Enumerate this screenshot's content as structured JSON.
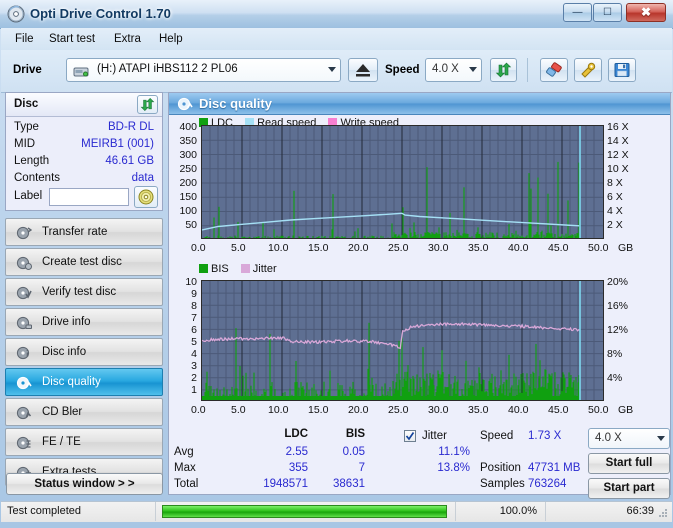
{
  "window": {
    "title": "Opti Drive Control 1.70",
    "icon": "disc-icon",
    "buttons": {
      "minimize": "–",
      "maximize": "❐",
      "close": "✕"
    }
  },
  "menu": {
    "items": [
      "File",
      "Start test",
      "Extra",
      "Help"
    ]
  },
  "toolbar": {
    "drive_label": "Drive",
    "drive_value": "(H:)  ATAPI iHBS112  2 PL06",
    "eject_icon": "eject-icon",
    "speed_label": "Speed",
    "speed_value": "4.0 X",
    "refresh_icon": "refresh-icon",
    "erase_icon": "eraser-icon",
    "tools_icon": "tools-icon",
    "save_icon": "save-icon"
  },
  "disc": {
    "header": "Disc",
    "refresh_icon": "refresh-icon",
    "rows": [
      {
        "key": "Type",
        "value": "BD-R DL"
      },
      {
        "key": "MID",
        "value": "MEIRB1 (001)"
      },
      {
        "key": "Length",
        "value": "46.61 GB"
      },
      {
        "key": "Contents",
        "value": "data"
      }
    ],
    "label_key": "Label",
    "label_value": "",
    "label_placeholder": "",
    "label_button_icon": "disc-icon"
  },
  "nav": {
    "items": [
      {
        "label": "Transfer rate",
        "icon": "disc-transfer-icon",
        "selected": false
      },
      {
        "label": "Create test disc",
        "icon": "disc-create-icon",
        "selected": false
      },
      {
        "label": "Verify test disc",
        "icon": "disc-verify-icon",
        "selected": false
      },
      {
        "label": "Drive info",
        "icon": "disc-drive-icon",
        "selected": false
      },
      {
        "label": "Disc info",
        "icon": "disc-info-icon",
        "selected": false
      },
      {
        "label": "Disc quality",
        "icon": "disc-quality-icon",
        "selected": true
      },
      {
        "label": "CD Bler",
        "icon": "disc-bler-icon",
        "selected": false
      },
      {
        "label": "FE / TE",
        "icon": "disc-fete-icon",
        "selected": false
      },
      {
        "label": "Extra tests",
        "icon": "disc-extra-icon",
        "selected": false
      }
    ],
    "status_window": "Status window > >"
  },
  "content": {
    "title": "Disc quality",
    "icon": "disc-quality-icon"
  },
  "chart_data": [
    {
      "type": "line",
      "title": "LDC / Read speed",
      "xlabel": "GB",
      "ylabel": "LDC errors",
      "x_ticks": [
        "0.0",
        "5.0",
        "10.0",
        "15.0",
        "20.0",
        "25.0",
        "30.0",
        "35.0",
        "40.0",
        "45.0",
        "50.0"
      ],
      "xlim": [
        0,
        50
      ],
      "y_left_ticks": [
        "50",
        "100",
        "150",
        "200",
        "250",
        "300",
        "350",
        "400"
      ],
      "ylim": [
        0,
        400
      ],
      "y_right_ticks": [
        "2 X",
        "4 X",
        "6 X",
        "8 X",
        "10 X",
        "12 X",
        "14 X",
        "16 X"
      ],
      "ylim_right": [
        0,
        16
      ],
      "x_unit": "GB",
      "grid": true,
      "legend": [
        {
          "label": "LDC",
          "color": "#10a010"
        },
        {
          "label": "Read speed",
          "color": "#a5e0f5"
        },
        {
          "label": "Write speed",
          "color": "#f77fd0"
        }
      ],
      "series": [
        {
          "name": "Read speed",
          "color": "#a5e0f5",
          "unit": "X",
          "x": [
            0,
            2,
            5,
            8,
            11,
            14,
            17,
            20,
            23,
            24.8,
            25.2,
            27,
            30,
            33,
            36,
            39,
            42,
            45,
            46.8
          ],
          "values": [
            1.4,
            1.9,
            2.2,
            2.5,
            2.8,
            3.0,
            3.2,
            3.4,
            3.6,
            3.75,
            3.5,
            3.3,
            3.1,
            2.9,
            2.7,
            2.5,
            2.3,
            2.1,
            2.0
          ]
        },
        {
          "name": "LDC",
          "color": "#10a010",
          "description": "dense green error spikes across the whole disc, mostly below 60 with occasional peaks to 355",
          "avg": 2.55,
          "max": 355,
          "total": 1948571
        }
      ]
    },
    {
      "type": "line",
      "title": "BIS / Jitter",
      "xlabel": "GB",
      "ylabel": "BIS errors",
      "x_ticks": [
        "0.0",
        "5.0",
        "10.0",
        "15.0",
        "20.0",
        "25.0",
        "30.0",
        "35.0",
        "40.0",
        "45.0",
        "50.0"
      ],
      "xlim": [
        0,
        50
      ],
      "y_left_ticks": [
        "1",
        "2",
        "3",
        "4",
        "5",
        "6",
        "7",
        "8",
        "9",
        "10"
      ],
      "ylim": [
        0,
        10
      ],
      "y_right_ticks": [
        "4%",
        "8%",
        "12%",
        "16%",
        "20%"
      ],
      "ylim_right": [
        0,
        20
      ],
      "x_unit": "GB",
      "grid": true,
      "legend": [
        {
          "label": "BIS",
          "color": "#10a010"
        },
        {
          "label": "Jitter",
          "color": "#d9a8d9"
        }
      ],
      "series": [
        {
          "name": "Jitter",
          "color": "#d9a8d9",
          "unit": "%",
          "x": [
            0,
            3,
            7,
            10,
            11,
            14,
            18,
            21,
            23,
            24.6,
            24.9,
            26,
            28,
            31,
            34,
            37,
            40,
            43,
            46,
            46.9
          ],
          "values": [
            10.2,
            10.4,
            10.5,
            10.6,
            10.0,
            9.9,
            10.1,
            10.0,
            9.6,
            9.1,
            11.8,
            12.4,
            12.8,
            12.9,
            12.8,
            12.6,
            12.5,
            12.2,
            12.0,
            11.9
          ]
        },
        {
          "name": "BIS",
          "color": "#10a010",
          "description": "dense green spikes along the baseline, denser after the 25 GB layer break",
          "avg": 0.05,
          "max": 7,
          "total": 38631
        }
      ]
    }
  ],
  "stats": {
    "col_headers": [
      "LDC",
      "BIS"
    ],
    "row_headers": [
      "Avg",
      "Max",
      "Total"
    ],
    "ldc": {
      "avg": "2.55",
      "max": "355",
      "total": "1948571"
    },
    "bis": {
      "avg": "0.05",
      "max": "7",
      "total": "38631"
    },
    "jitter": {
      "label": "Jitter",
      "checked": true,
      "avg": "11.1%",
      "max": "13.8%"
    },
    "speed_label": "Speed",
    "speed_value": "1.73 X",
    "position_label": "Position",
    "position_value": "47731 MB",
    "samples_label": "Samples",
    "samples_value": "763264",
    "speed_select": "4.0 X",
    "start_full": "Start full",
    "start_part": "Start part"
  },
  "statusbar": {
    "text": "Test completed",
    "progress": "100.0%",
    "progress_value": 100,
    "time": "66:39"
  },
  "colors": {
    "accent": "#1894d2",
    "value_text": "#2a2ad0",
    "plot_bg": "#5e6f92",
    "ldc_green": "#10a010",
    "read_speed": "#a5e0f5",
    "write_speed": "#f77fd0",
    "jitter": "#d9a8d9",
    "progress_green": "#2fc21b"
  }
}
